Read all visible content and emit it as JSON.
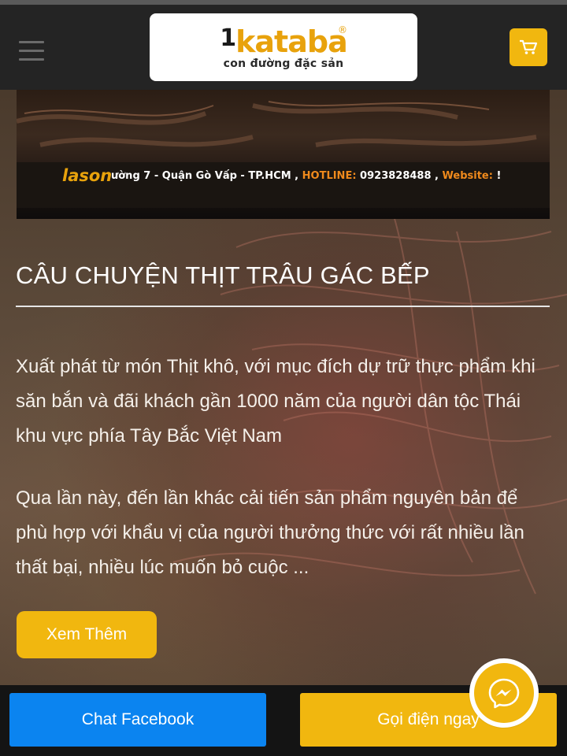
{
  "header": {
    "logo_text_k": "1",
    "logo_text_rest": "kataba",
    "logo_reg": "®",
    "logo_tagline": "con đường đặc sản"
  },
  "banner": {
    "brand": "lason",
    "address": "ường 7 - Quận Gò Vấp - TP.HCM , ",
    "hotline_label": "HOTLINE:",
    "hotline_number": " 0923828488 , ",
    "website_label": "Website: ",
    "website_tail": "!"
  },
  "article": {
    "title": "CÂU CHUYỆN THỊT TRÂU GÁC BẾP",
    "paragraph_1": "Xuất phát từ món Thịt khô, với mục đích dự trữ thực phẩm khi săn bắn và đãi khách gần 1000 năm của người dân tộc Thái khu vực phía Tây Bắc Việt Nam",
    "paragraph_2": "Qua lần này, đến lần khác cải tiến sản phẩm nguyên bản để phù hợp với khẩu vị của người thưởng thức với rất nhiều lần thất bại, nhiều lúc muốn bỏ cuộc ...",
    "more_label": "Xem Thêm"
  },
  "bottom_bar": {
    "chat_label": "Chat Facebook",
    "call_label": "Gọi điện ngay"
  },
  "colors": {
    "accent": "#f1b70f",
    "facebook_blue": "#0b84f0",
    "header_bg": "#242424"
  },
  "icons": {
    "menu": "hamburger-icon",
    "cart": "cart-icon",
    "messenger": "messenger-icon"
  }
}
